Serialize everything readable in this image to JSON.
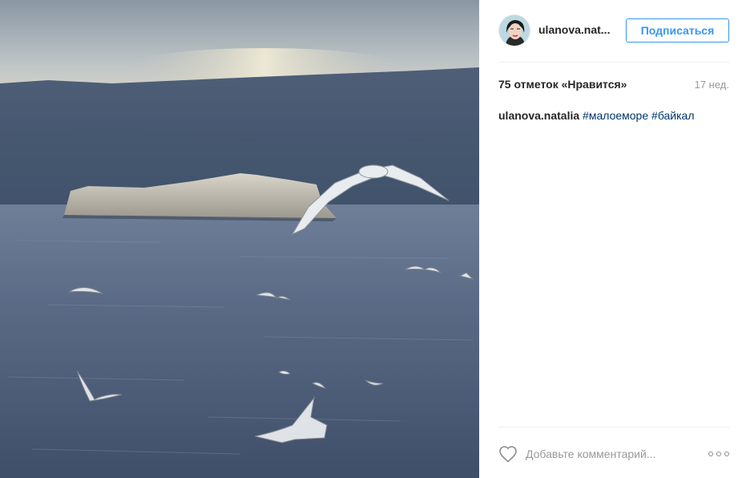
{
  "post": {
    "username": "ulanova.nat...",
    "follow_label": "Подписаться",
    "likes_text": "75 отметок «Нравится»",
    "time_ago": "17 нед.",
    "caption": {
      "author": "ulanova.natalia",
      "hashtags": [
        "#малоеморе",
        "#байкал"
      ]
    },
    "comment_placeholder": "Добавьте комментарий..."
  },
  "icons": {
    "like": "heart-outline-icon",
    "options": "more-options-icon",
    "avatar": "profile-avatar"
  },
  "colors": {
    "accent": "#3897f0",
    "hashtag": "#003569",
    "muted": "#999999",
    "text": "#262626"
  }
}
